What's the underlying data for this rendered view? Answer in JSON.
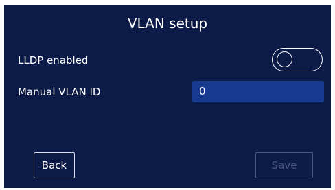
{
  "header": {
    "title": "VLAN setup"
  },
  "settings": {
    "lldp": {
      "label": "LLDP enabled",
      "enabled": false
    },
    "vlan": {
      "label": "Manual VLAN ID",
      "value": "0"
    }
  },
  "buttons": {
    "back_label": "Back",
    "save_label": "Save",
    "save_enabled": false
  },
  "colors": {
    "background": "#0c1a48",
    "input_fill": "#183a8e",
    "text": "#ffffff",
    "disabled": "#4a5680"
  }
}
